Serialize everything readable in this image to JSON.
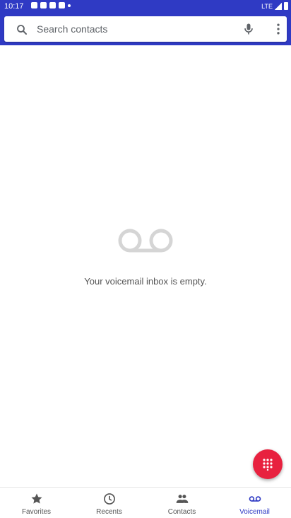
{
  "status_bar": {
    "time": "10:17",
    "network": "LTE"
  },
  "search": {
    "placeholder": "Search contacts"
  },
  "empty_state": {
    "message": "Your voicemail inbox is empty."
  },
  "bottom_nav": {
    "items": [
      {
        "label": "Favorites",
        "icon": "star-icon",
        "active": false
      },
      {
        "label": "Recents",
        "icon": "clock-icon",
        "active": false
      },
      {
        "label": "Contacts",
        "icon": "people-icon",
        "active": false
      },
      {
        "label": "Voicemail",
        "icon": "voicemail-icon",
        "active": true
      }
    ]
  },
  "colors": {
    "primary": "#2f3ac4",
    "fab": "#e8213f",
    "empty_icon": "#d5d5d5"
  }
}
